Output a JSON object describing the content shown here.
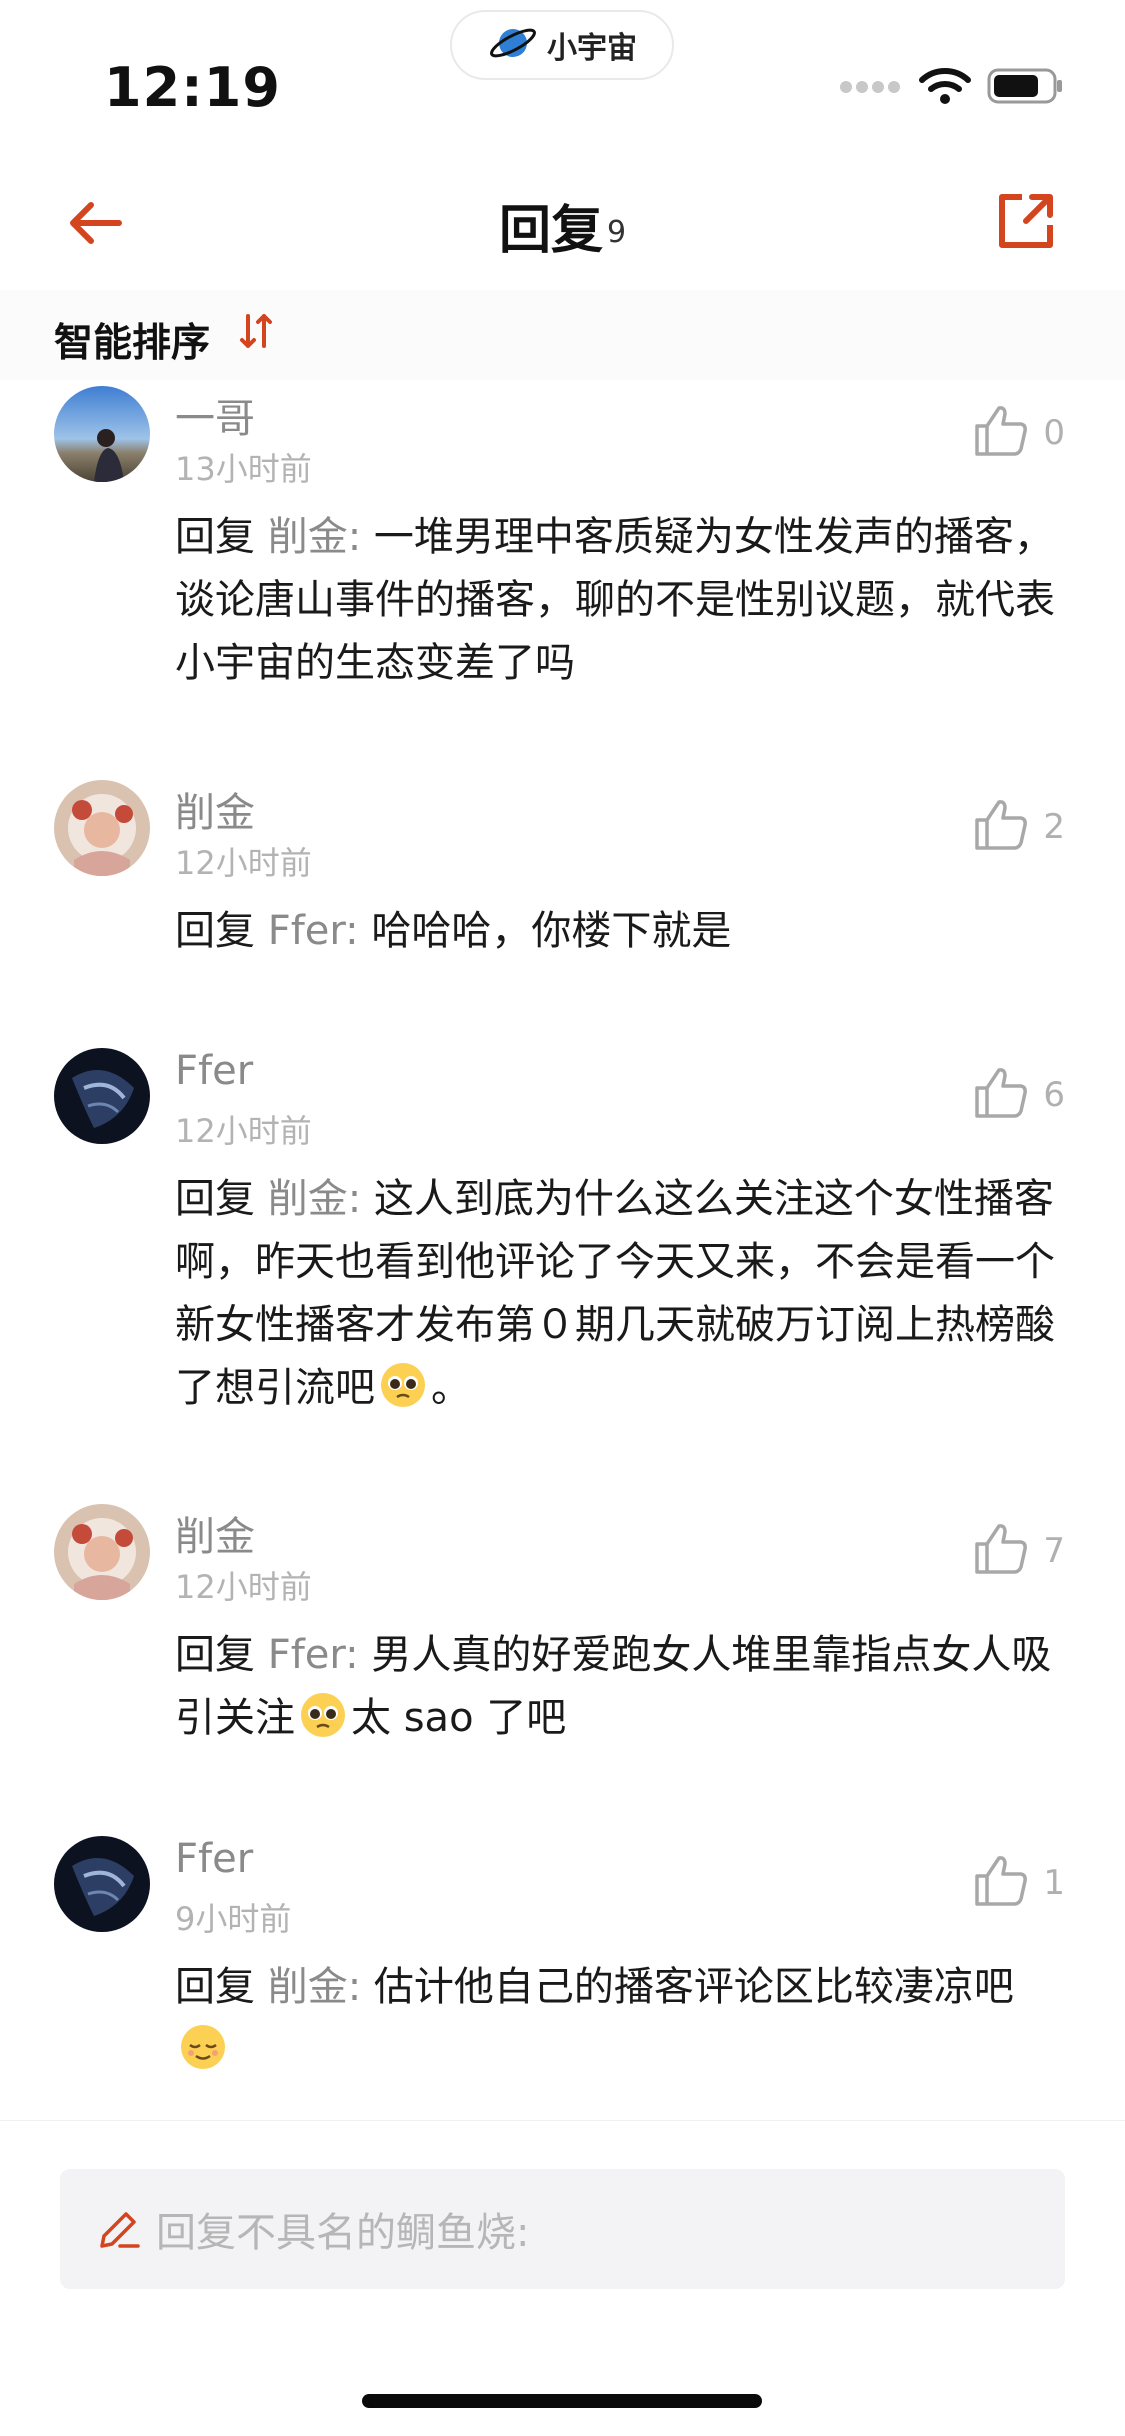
{
  "status_bar": {
    "time": "12:19",
    "app_pill_label": "小宇宙"
  },
  "nav": {
    "title": "回复",
    "count": "9"
  },
  "sort": {
    "label": "智能排序"
  },
  "comments": [
    {
      "author": "一哥",
      "time": "13小时前",
      "likes": "0",
      "prefix": "回复",
      "target": "削金:",
      "text": " 一堆男理中客质疑为女性发声的播客，谈论唐山事件的播客，聊的不是性别议题，就代表小宇宙的生态变差了吗",
      "avatar": "landscape"
    },
    {
      "author": "削金",
      "time": "12小时前",
      "likes": "2",
      "prefix": "回复",
      "target": "Ffer:",
      "text": " 哈哈哈，你楼下就是",
      "avatar": "portrait"
    },
    {
      "author": "Ffer",
      "time": "12小时前",
      "likes": "6",
      "prefix": "回复",
      "target": "削金:",
      "text": " 这人到底为什么这么关注这个女性播客啊，昨天也看到他评论了今天又来，不会是看一个新女性播客才发布第０期几天就破万订阅上热榜酸了想引流吧",
      "text_after": "。",
      "avatar": "dark"
    },
    {
      "author": "削金",
      "time": "12小时前",
      "likes": "7",
      "prefix": "回复",
      "target": "Ffer:",
      "text": " 男人真的好爱跑女人堆里靠指点女人吸引关注",
      "text_after": "太 sao 了吧",
      "avatar": "portrait"
    },
    {
      "author": "Ffer",
      "time": "9小时前",
      "likes": "1",
      "prefix": "回复",
      "target": "削金:",
      "text": " 估计他自己的播客评论区比较凄凉吧",
      "avatar": "dark"
    }
  ],
  "reply_input": {
    "placeholder": "回复不具名的鲷鱼烧:"
  },
  "colors": {
    "accent": "#d2451e",
    "secondary_text": "#8a8a8a"
  }
}
